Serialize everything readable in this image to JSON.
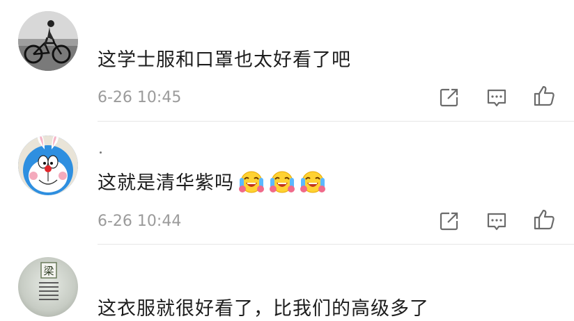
{
  "comments": [
    {
      "text": "这学士服和口罩也太好看了吧",
      "time": "6-26 10:45",
      "avatar": "cyclist-photo",
      "emojis": []
    },
    {
      "text": "这就是清华紫吗",
      "time": "6-26 10:44",
      "avatar": "doraemon-bunny-ears",
      "emojis": [
        "laughing-crying-face",
        "laughing-crying-face",
        "laughing-crying-face"
      ]
    },
    {
      "text": "这衣服就很好看了，比我们的高级多了",
      "avatar": "liang-character-badge",
      "avatar_char": "梁",
      "emojis": []
    }
  ],
  "actions": {
    "icons": [
      "share-icon",
      "comment-icon",
      "like-icon"
    ]
  },
  "colors": {
    "meta_text": "#9b9b9b",
    "icon": "#6b6b6b",
    "divider": "#e6e6e6"
  }
}
